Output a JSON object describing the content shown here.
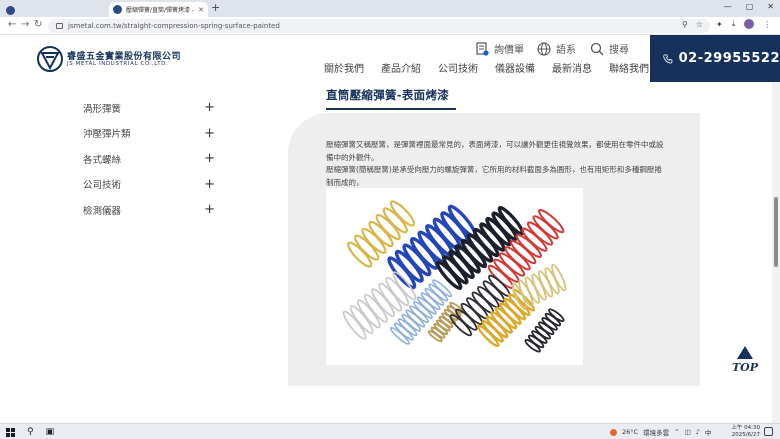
{
  "browser": {
    "tabs": [
      {
        "title": ""
      },
      {
        "title": "壓縮彈簧/直筒/彈簧烤漆 - 睿盛..."
      }
    ],
    "url": "jsmetal.com.tw/straight-compression-spring-surface-painted",
    "icons": [
      "back-icon",
      "forward-icon",
      "reload-icon",
      "zoom-icon",
      "star-icon",
      "extensions-icon",
      "download-icon",
      "profile-icon"
    ]
  },
  "header": {
    "brand_zh": "睿盛五金實業股份有限公司",
    "brand_en": "JS METAL INDUSTRIAL CO.,LTD.",
    "inquiry_label": "詢價單",
    "language_label": "語系",
    "search_label": "搜尋",
    "nav": [
      "關於我們",
      "產品介紹",
      "公司技術",
      "儀器設備",
      "最新消息",
      "聯絡我們"
    ],
    "phone": "02-29955522",
    "brand_color": "#16325c"
  },
  "sidebar": {
    "items": [
      {
        "label": "渦形彈簧"
      },
      {
        "label": "沖壓彈片類"
      },
      {
        "label": "各式螺絲"
      },
      {
        "label": "公司技術"
      },
      {
        "label": "檢測儀器"
      }
    ]
  },
  "content": {
    "title": "直筒壓縮彈簧-表面烤漆",
    "desc_1": "壓縮彈簧又稱壓簧，是彈簧裡面最常見的，表面烤漆，可以讓外觀更佳視覺效果，都使用在零件中或設備中的外觀件。",
    "desc_2": "壓縮彈簧(簡稱壓簧)是承受向壓力的螺旋彈簧，它所用的材料截面多為圓形，也有用矩形和多種鋼壓捲制而成的，"
  },
  "top_button": {
    "label": "TOP"
  },
  "taskbar": {
    "temperature": "26°C",
    "weather": "環境多雲",
    "ime": "中",
    "time": "上午 04:30",
    "date": "2025/6/27"
  }
}
